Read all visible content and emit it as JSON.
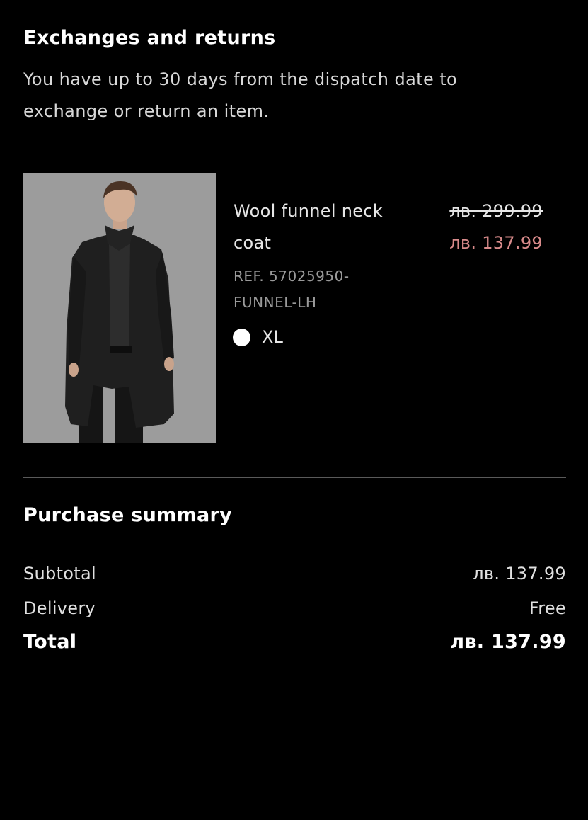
{
  "exchanges": {
    "title": "Exchanges and returns",
    "text": "You have up to 30 days from the dispatch date to exchange or return an item."
  },
  "product": {
    "name": "Wool funnel neck coat",
    "price_old": "лв. 299.99",
    "price_new": "лв. 137.99",
    "reference": "REF. 57025950-FUNNEL-LH",
    "color_swatch": "#ffffff",
    "size": "XL"
  },
  "summary": {
    "title": "Purchase summary",
    "subtotal_label": "Subtotal",
    "subtotal_value": "лв. 137.99",
    "delivery_label": "Delivery",
    "delivery_value": "Free",
    "total_label": "Total",
    "total_value": "лв. 137.99"
  },
  "colors": {
    "background": "#000000",
    "sale_price": "#d98b8b",
    "divider": "#5a5a5a"
  }
}
